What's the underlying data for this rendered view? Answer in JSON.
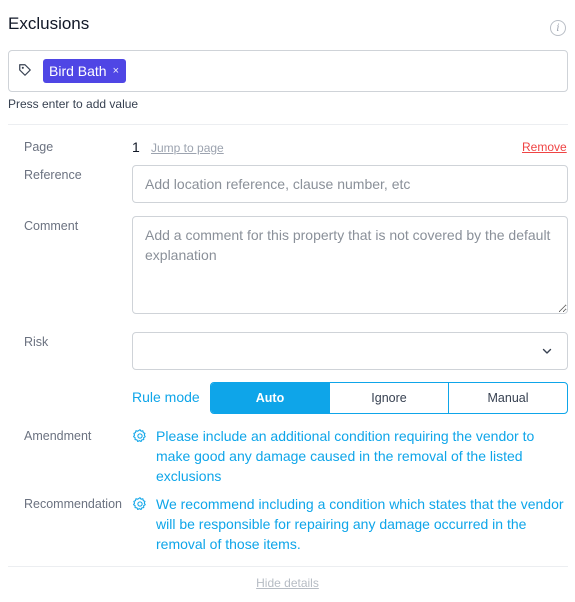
{
  "header": {
    "title": "Exclusions"
  },
  "tags": {
    "items": [
      {
        "label": "Bird Bath",
        "remove": "×"
      }
    ],
    "hint": "Press enter to add value"
  },
  "page": {
    "label": "Page",
    "value": "1",
    "jump_label": "Jump to page",
    "remove_label": "Remove"
  },
  "reference": {
    "label": "Reference",
    "placeholder": "Add location reference, clause number, etc"
  },
  "comment": {
    "label": "Comment",
    "placeholder": "Add a comment for this property that is not covered by the default explanation"
  },
  "risk": {
    "label": "Risk",
    "value": ""
  },
  "rule_mode": {
    "label": "Rule mode",
    "options": [
      "Auto",
      "Ignore",
      "Manual"
    ],
    "selected": "Auto"
  },
  "amendment": {
    "label": "Amendment",
    "text": "Please include an additional condition requiring the vendor to make good any damage caused in the removal of the listed exclusions"
  },
  "recommendation": {
    "label": "Recommendation",
    "text": "We recommend including a condition which states that the vendor will be responsible for repairing any damage occurred in the removal of those items."
  },
  "footer": {
    "hide_details": "Hide details"
  },
  "colors": {
    "accent": "#0ea5e9",
    "chip": "#4f46e5",
    "danger": "#ef4444"
  }
}
